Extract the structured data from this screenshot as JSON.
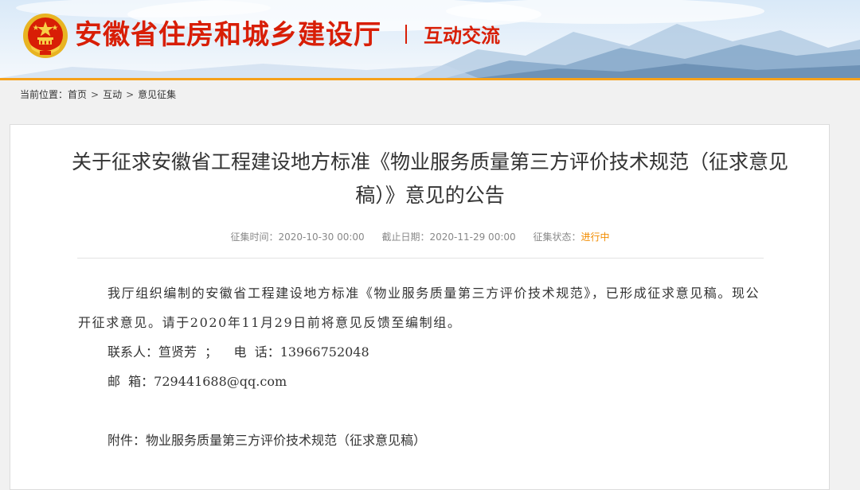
{
  "header": {
    "site_name": "安徽省住房和城乡建设厅",
    "section_name": "互动交流",
    "emblem_icon": "national-emblem-icon"
  },
  "colors": {
    "brand_red": "#d81e06",
    "accent_orange": "#f6a11a",
    "status_orange": "#f28c00"
  },
  "breadcrumb": {
    "label": "当前位置：",
    "items": [
      "首页",
      "互动",
      "意见征集"
    ],
    "separator": ">"
  },
  "article": {
    "title": "关于征求安徽省工程建设地方标准《物业服务质量第三方评价技术规范（征求意见稿）》意见的公告",
    "meta": {
      "start_label": "征集时间：",
      "start_value": "2020-10-30 00:00",
      "end_label": "截止日期：",
      "end_value": "2020-11-29 00:00",
      "status_label": "征集状态：",
      "status_value": "进行中"
    },
    "paragraph": "我厅组织编制的安徽省工程建设地方标准《物业服务质量第三方评价技术规范》，已形成征求意见稿。现公开征求意见。请于2020年11月29日前将意见反馈至编制组。",
    "contact_line": "联系人：笪贤芳  ；    电  话：13966752048",
    "email_line": "邮  箱：729441688@qq.com",
    "attachment_line": "附件：物业服务质量第三方评价技术规范（征求意见稿）"
  }
}
